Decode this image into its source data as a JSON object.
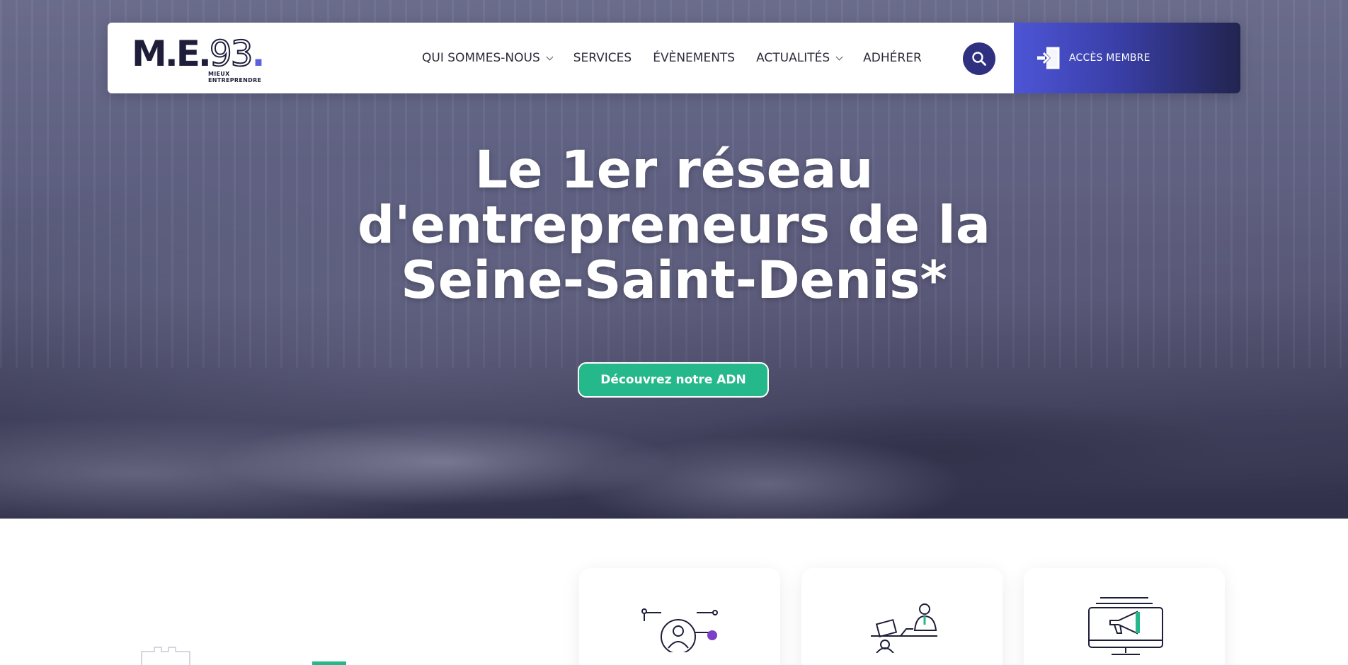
{
  "header": {
    "logo": {
      "text_main": "M.E.",
      "text_number": "93",
      "text_dot": ".",
      "sub_line1": "MIEUX",
      "sub_line2": "ENTREPRENDRE"
    },
    "nav": [
      {
        "label": "QUI SOMMES-NOUS",
        "has_dropdown": true
      },
      {
        "label": "SERVICES",
        "has_dropdown": false
      },
      {
        "label": "ÉVÈNEMENTS",
        "has_dropdown": false
      },
      {
        "label": "ACTUALITÉS",
        "has_dropdown": true
      },
      {
        "label": "ADHÉRER",
        "has_dropdown": false
      }
    ],
    "search_icon": "search-icon",
    "member_button": {
      "label": "ACCÈS MEMBRE",
      "icon": "login-icon"
    }
  },
  "hero": {
    "title_lines": [
      "Le 1er réseau",
      "d'entrepreneurs de la",
      "Seine-Saint-Denis*"
    ],
    "cta_label": "Découvrez notre ADN"
  },
  "features": {
    "cards": [
      {
        "icon": "network-person-icon"
      },
      {
        "icon": "coaching-desk-icon"
      },
      {
        "icon": "monitor-megaphone-icon"
      }
    ]
  },
  "colors": {
    "accent_green": "#25b88a",
    "brand_navy": "#2f3180",
    "brand_violet": "#5b5fe0",
    "hero_tint": "#40426e"
  }
}
